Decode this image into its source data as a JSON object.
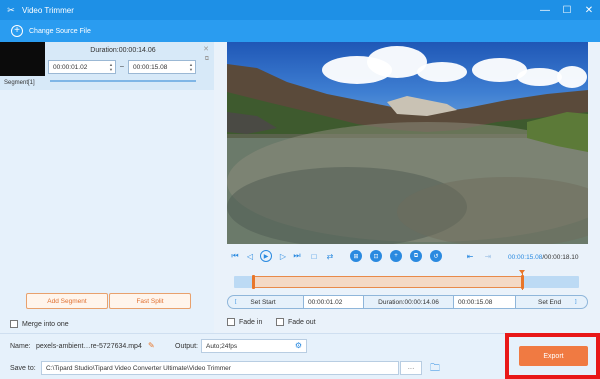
{
  "window": {
    "title": "Video Trimmer",
    "minimize": "—",
    "maximize": "☐",
    "close": "✕"
  },
  "source": {
    "label": "Change Source File"
  },
  "segment": {
    "duration": "Duration:00:00:14.06",
    "label": "Segment[1]",
    "start": "00:00:01.02",
    "end": "00:00:15.08",
    "separator": "–"
  },
  "left_buttons": {
    "add": "Add Segment",
    "split": "Fast Split"
  },
  "merge": {
    "label": "Merge into one"
  },
  "player": {
    "current_time": "00:00:15.08",
    "total_time": "/00:00:18.10"
  },
  "timeline": {
    "selection_start": 0.06,
    "selection_end": 0.83,
    "playhead": 0.83
  },
  "trim": {
    "set_start": "Set Start",
    "start_value": "00:00:01.02",
    "duration": "Duration:00:00:14.06",
    "end_value": "00:00:15.08",
    "set_end": "Set End"
  },
  "fade": {
    "fade_in": "Fade in",
    "fade_out": "Fade out"
  },
  "output": {
    "name_label": "Name:",
    "name_value": "pexels-ambient…re-5727634.mp4",
    "output_label": "Output:",
    "output_value": "Auto;24fps",
    "save_label": "Save to:",
    "save_path": "C:\\Tipard Studio\\Tipard Video Converter Ultimate\\Video Trimmer",
    "browse": "···",
    "export": "Export"
  }
}
